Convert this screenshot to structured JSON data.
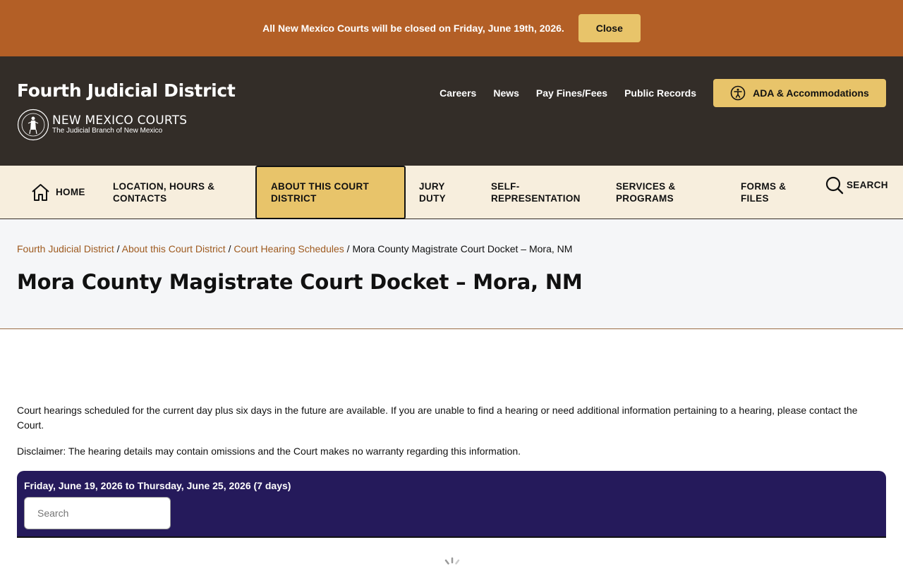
{
  "alert": {
    "message": "All New Mexico Courts will be closed on Friday, June 19th, 2026.",
    "close_label": "Close"
  },
  "header": {
    "site_title": "Fourth Judicial District",
    "brand_name": "NEW MEXICO COURTS",
    "brand_tagline": "The Judicial Branch of New Mexico",
    "util_links": [
      "Careers",
      "News",
      "Pay Fines/Fees",
      "Public Records"
    ],
    "ada_label": "ADA & Accommodations"
  },
  "nav": {
    "items": [
      {
        "label": "HOME",
        "icon": "home-icon"
      },
      {
        "label": "LOCATION, HOURS & CONTACTS"
      },
      {
        "label": "ABOUT THIS COURT DISTRICT",
        "active": true
      },
      {
        "label": "JURY DUTY"
      },
      {
        "label": "SELF-REPRESENTATION"
      },
      {
        "label": "SERVICES & PROGRAMS"
      },
      {
        "label": "FORMS & FILES"
      },
      {
        "label": "SEARCH",
        "icon": "search-icon"
      }
    ]
  },
  "breadcrumb": {
    "items": [
      "Fourth Judicial District",
      "About this Court District",
      "Court Hearing Schedules"
    ],
    "current": "Mora County Magistrate Court Docket – Mora, NM"
  },
  "page": {
    "title": "Mora County Magistrate Court Docket – Mora, NM",
    "intro": "Court hearings scheduled for the current day plus six days in the future are available. If you are unable to find a hearing or need additional information pertaining to a hearing, please contact the Court.",
    "disclaimer": "Disclaimer:  The hearing details may contain omissions and the Court makes no warranty regarding this information."
  },
  "docket": {
    "range_label": "Friday, June 19, 2026 to Thursday, June 25, 2026 (7 days)",
    "search_placeholder": "Search"
  },
  "colors": {
    "alert_bg": "#b35f26",
    "header_bg": "#332d28",
    "accent_gold": "#e8c46a",
    "nav_bg": "#f7eedd",
    "link": "#9e5a1f",
    "docket_bg": "#251a5b"
  }
}
